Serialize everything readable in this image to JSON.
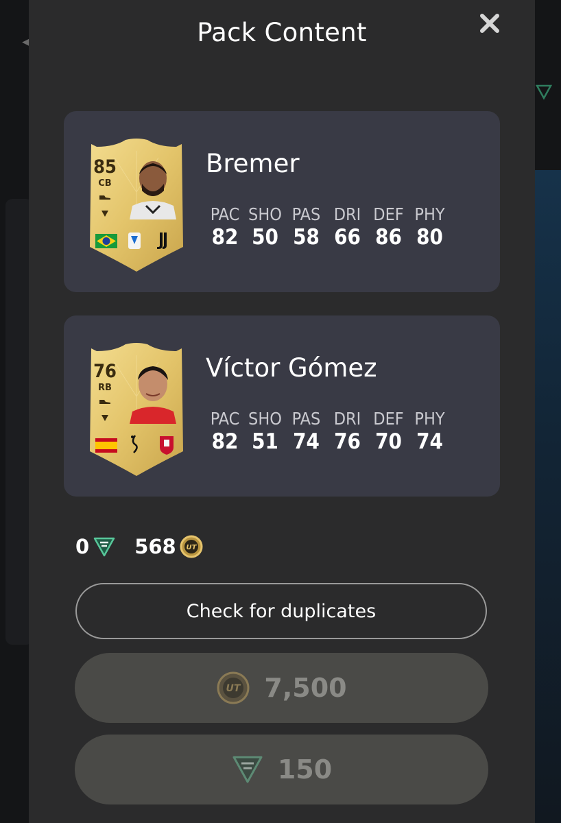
{
  "modal": {
    "title": "Pack Content",
    "close_icon": "close-icon"
  },
  "players": [
    {
      "rating": "85",
      "position": "CB",
      "name": "Bremer",
      "nation": "Brazil flag",
      "league": "Serie A badge",
      "club": "Juventus crest",
      "stats": [
        {
          "label": "PAC",
          "value": "82"
        },
        {
          "label": "SHO",
          "value": "50"
        },
        {
          "label": "PAS",
          "value": "58"
        },
        {
          "label": "DRI",
          "value": "66"
        },
        {
          "label": "DEF",
          "value": "86"
        },
        {
          "label": "PHY",
          "value": "80"
        }
      ]
    },
    {
      "rating": "76",
      "position": "RB",
      "name": "Víctor Gómez",
      "nation": "Spain flag",
      "league": "Liga Portugal badge",
      "club": "Braga crest",
      "stats": [
        {
          "label": "PAC",
          "value": "82"
        },
        {
          "label": "SHO",
          "value": "51"
        },
        {
          "label": "PAS",
          "value": "74"
        },
        {
          "label": "DRI",
          "value": "76"
        },
        {
          "label": "DEF",
          "value": "70"
        },
        {
          "label": "PHY",
          "value": "74"
        }
      ]
    }
  ],
  "balance": {
    "fc_points": "0",
    "coins": "568",
    "fc_points_icon": "fc-points-icon",
    "coins_icon": "ut-coin-icon"
  },
  "buttons": {
    "check_duplicates": "Check for duplicates",
    "buy_coins": "7,500",
    "buy_points": "150"
  },
  "colors": {
    "modal_bg": "#2b2b2c",
    "row_bg": "#393a45",
    "card_gold": "#e3c56a",
    "disabled_button": "#4a4a47",
    "fc_points_green": "#3aa57a"
  }
}
